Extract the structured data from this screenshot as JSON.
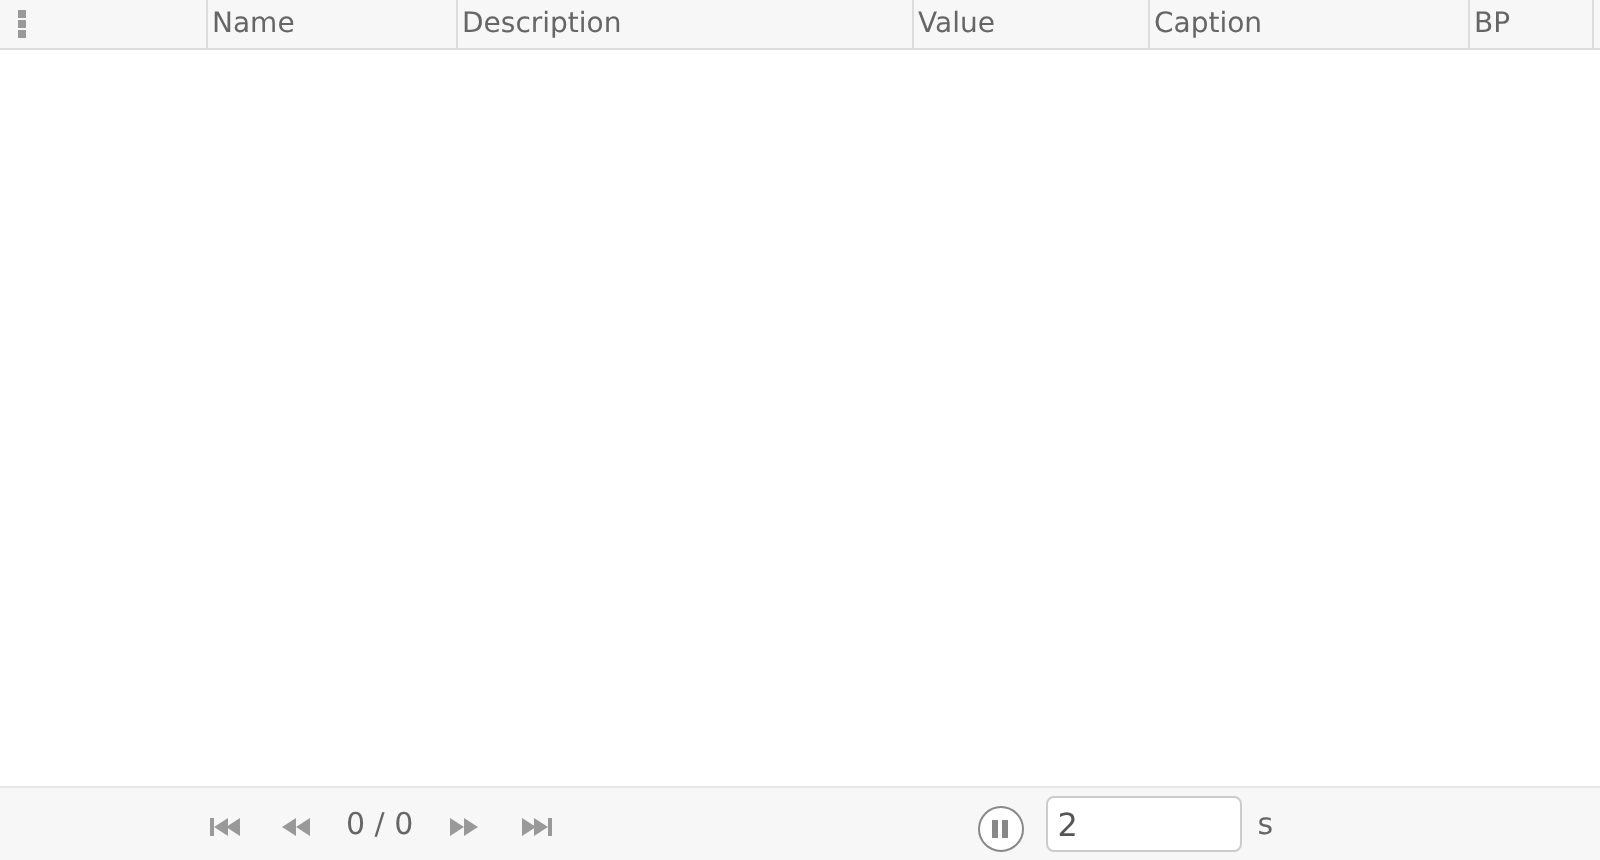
{
  "table": {
    "columns": [
      "Name",
      "Description",
      "Value",
      "Caption",
      "BP"
    ]
  },
  "footer": {
    "counter": "0 / 0",
    "interval": "2",
    "unit": "s"
  }
}
